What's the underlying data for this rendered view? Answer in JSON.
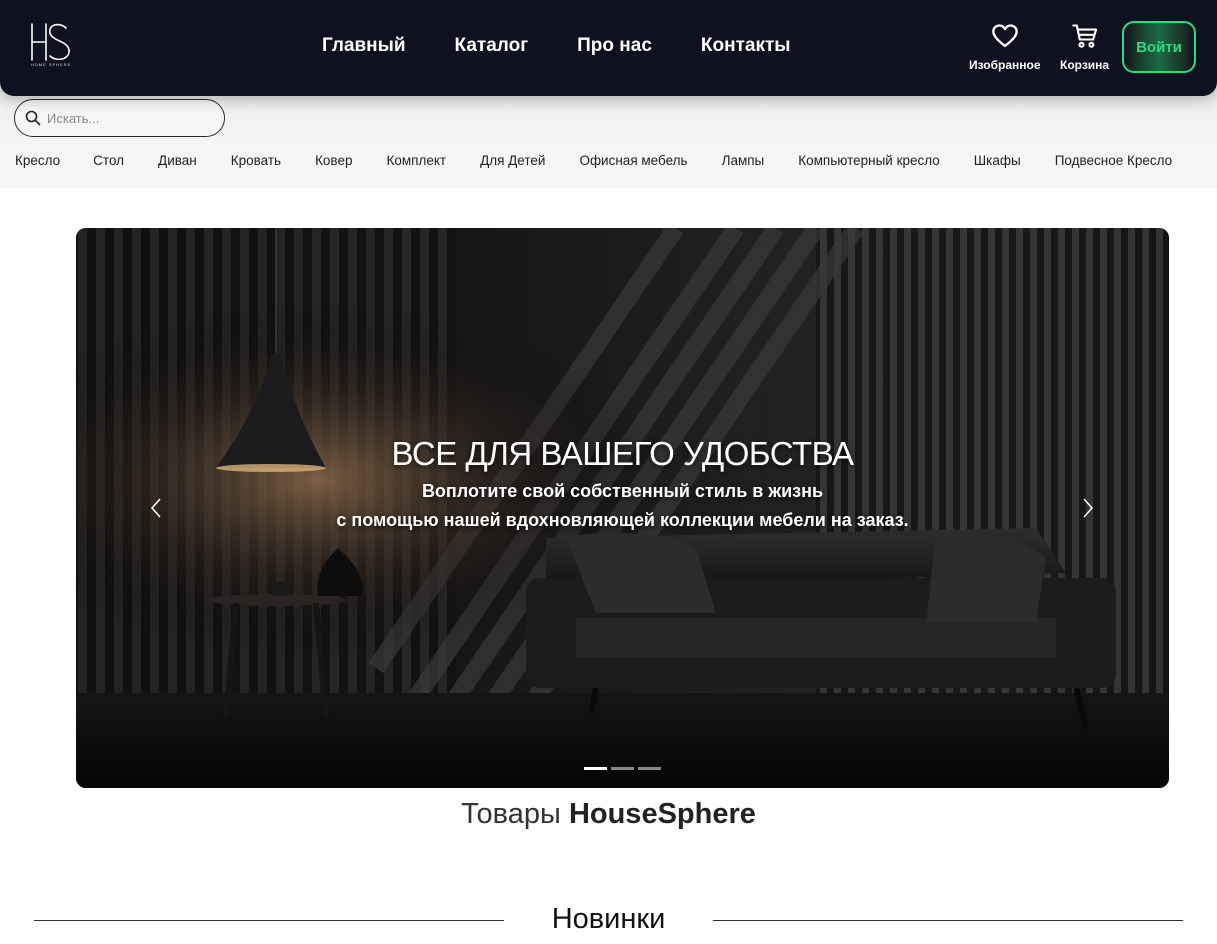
{
  "header": {
    "logo_text": "HOME SPHERE",
    "nav": [
      "Главный",
      "Каталог",
      "Про нас",
      "Контакты"
    ],
    "favorites_label": "Изобранное",
    "cart_label": "Корзина",
    "login_label": "Войти"
  },
  "search": {
    "placeholder": "Искать..."
  },
  "categories": [
    "Кресло",
    "Стол",
    "Диван",
    "Кровать",
    "Ковер",
    "Комплект",
    "Для Детей",
    "Офисная мебель",
    "Лампы",
    "Компьютерный кресло",
    "Шкафы",
    "Подвесное Кресло"
  ],
  "hero": {
    "title": "ВСЕ ДЛЯ ВАШЕГО УДОБСТВА",
    "subtitle_line1": "Воплотите свой собственный стиль в жизнь",
    "subtitle_line2": "с помощью нашей вдохновляющей коллекции мебели на заказ.",
    "slide_count": 3,
    "active_slide": 1
  },
  "products_section": {
    "prefix": "Товары",
    "brand": "HouseSphere"
  },
  "new_section": {
    "title": "Новинки"
  },
  "colors": {
    "header_bg": "#0f1120",
    "accent": "#22e07a"
  }
}
